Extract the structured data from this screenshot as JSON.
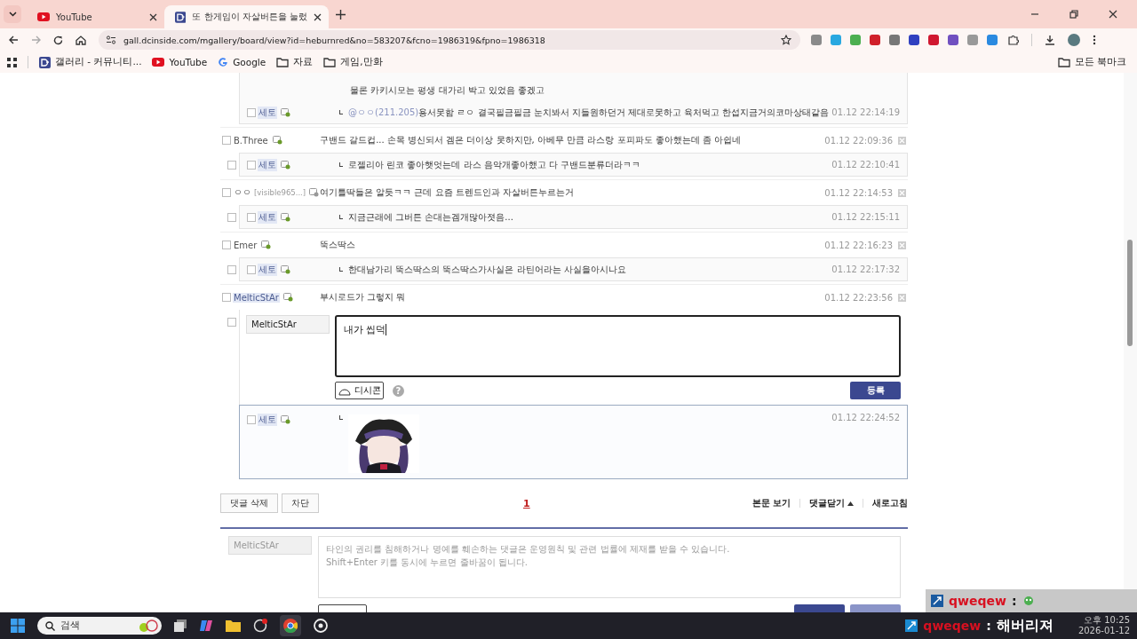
{
  "browser": {
    "tabs": [
      {
        "title": "YouTube",
        "selected": false
      },
      {
        "title": "또 한게임이 자살버튼을 눌렀",
        "selected": true
      }
    ],
    "url": "gall.dcinside.com/mgallery/board/view?id=heburnred&no=583207&fcno=1986319&fpno=1986318",
    "bookmarks": [
      "갤러리 - 커뮤니티...",
      "YouTube",
      "Google",
      "자료",
      "게임,만화"
    ],
    "all_bookmarks": "모든 북마크"
  },
  "threads": [
    {
      "boxes": [
        {
          "kind": "replies",
          "items": [
            {
              "kind": "line",
              "text": "물론 카키시모는 평생 대가리 박고 있었음 좋겠고"
            },
            {
              "kind": "reply",
              "author": "세토",
              "checked": false,
              "highlighted": true,
              "mention": "@ㅇㅇ(211.205)",
              "text": "용서못함 ㄹㅇ 결국필금필금 눈치봐서 지들원하던거 제대로못하고 육처먹고 한섭지금거의코마상태같음",
              "time": "01.12 22:14:19"
            }
          ]
        }
      ]
    },
    {
      "comment": {
        "author": "B.Three",
        "checked": false,
        "highlighted": false,
        "text": "구밴드 갈드컵... 손목 병신되서 겜은 더이상 못하지만, 아베무 만큼 라스랑 포피파도 좋아했는데 좀 아쉽네",
        "time": "01.12 22:09:36"
      },
      "boxes": [
        {
          "kind": "replies",
          "checked": false,
          "items": [
            {
              "kind": "reply",
              "author": "세토",
              "checked": false,
              "highlighted": true,
              "text": "로젤리아 린코 좋아햇엇는데 라스 음악개좋아했고 다 구밴드분류더라ㅋㅋ",
              "time": "01.12 22:10:41"
            }
          ]
        }
      ]
    },
    {
      "comment": {
        "author": "ㅇㅇ",
        "ip": "[visible965...]",
        "checked": false,
        "highlighted": false,
        "text": "여기틀딱들은 알듯ㅋㅋ 근데 요즘 트렌드인과 자살버튼누르는거",
        "time": "01.12 22:14:53"
      },
      "boxes": [
        {
          "kind": "replies",
          "checked": false,
          "items": [
            {
              "kind": "reply",
              "author": "세토",
              "checked": false,
              "highlighted": true,
              "text": "지금근래에 그버튼 손대는겜개많아졋음...",
              "time": "01.12 22:15:11"
            }
          ]
        }
      ]
    },
    {
      "comment": {
        "author": "Emer",
        "checked": false,
        "highlighted": false,
        "text": "뚝스딱스",
        "time": "01.12 22:16:23"
      },
      "boxes": [
        {
          "kind": "replies",
          "checked": false,
          "items": [
            {
              "kind": "reply",
              "author": "세토",
              "checked": false,
              "highlighted": true,
              "text": "한대남가리 뚝스딱스의 뚝스딱스가사실은 라틴어라는 사실을아시나요",
              "time": "01.12 22:17:32"
            }
          ]
        }
      ]
    },
    {
      "comment": {
        "author": "MelticStAr",
        "checked": false,
        "highlighted": true,
        "text": "부시로드가 그렇지 뭐",
        "time": "01.12 22:23:56"
      },
      "boxes": [
        {
          "kind": "form",
          "checked": false,
          "name": "MelticStAr",
          "value": "내가 씹덕",
          "dccon": "디시콘",
          "help": "?",
          "submit": "등록"
        },
        {
          "kind": "sticker",
          "author": "세토",
          "checked": false,
          "highlighted": true,
          "time": "01.12 22:24:52"
        }
      ]
    }
  ],
  "actions": {
    "buttons": [
      "댓글 삭제",
      "차단"
    ],
    "page": "1",
    "links": [
      {
        "label": "본문 보기",
        "caret": false
      },
      {
        "label": "댓글닫기",
        "caret": true
      },
      {
        "label": "새로고침",
        "caret": false
      }
    ]
  },
  "bottom_form": {
    "name": "MelticStAr",
    "placeholder": "타인의 권리를 침해하거나 명예를 훼손하는 댓글은 운영원칙 및 관련 법률에 제재를 받을 수 있습니다.\nShift+Enter 키를 동시에 누르면 줄바꿈이 됩니다."
  },
  "chat": [
    {
      "user": "qweqew",
      "separator": ":",
      "kind": "emote"
    },
    {
      "user": "qweqew",
      "separator": ":",
      "kind": "text",
      "message": "해버리져"
    }
  ],
  "taskbar": {
    "search": "검색",
    "time": "오후 10:25",
    "date": "2026-01-12"
  }
}
